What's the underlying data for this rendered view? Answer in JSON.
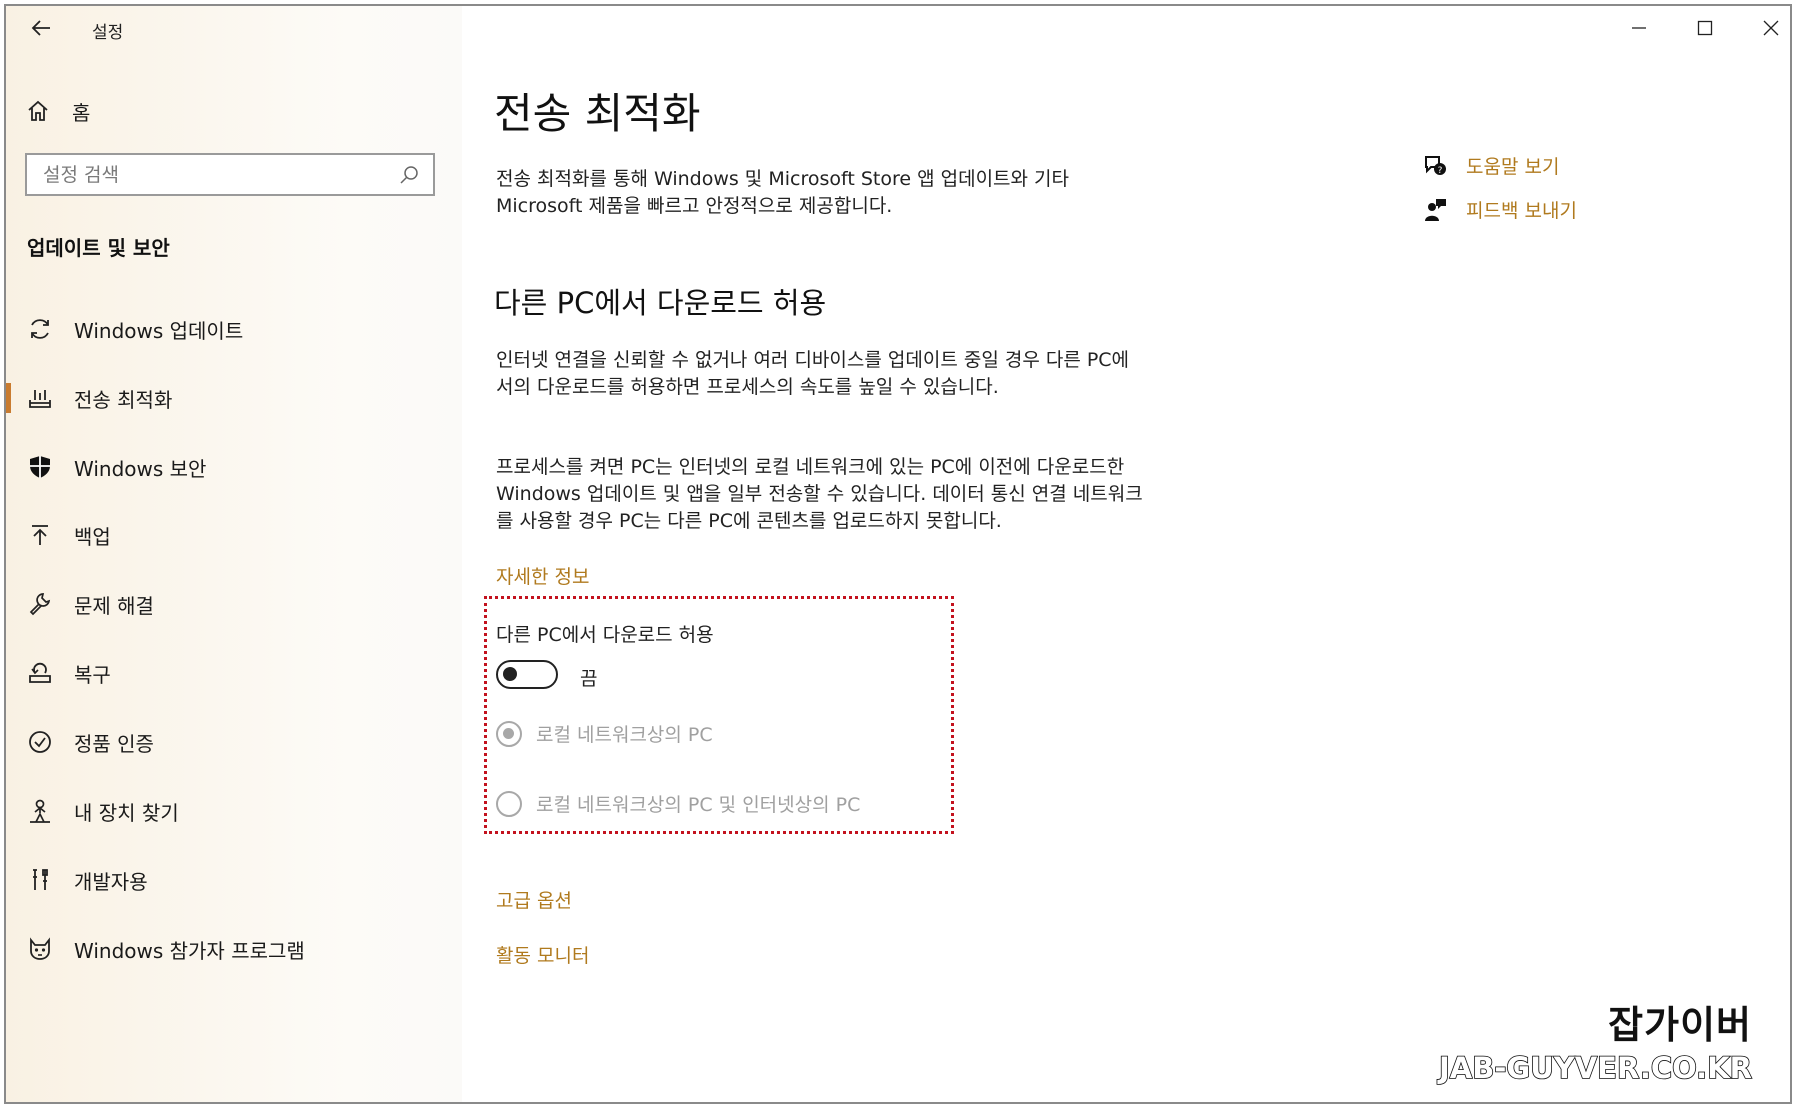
{
  "window": {
    "title": "설정"
  },
  "sidebar": {
    "home_label": "홈",
    "search_placeholder": "설정 검색",
    "section_heading": "업데이트 및 보안",
    "items": [
      {
        "label": "Windows 업데이트",
        "icon": "sync-icon"
      },
      {
        "label": "전송 최적화",
        "icon": "delivery-optimization-icon",
        "selected": true
      },
      {
        "label": "Windows 보안",
        "icon": "shield-icon"
      },
      {
        "label": "백업",
        "icon": "backup-arrow-icon"
      },
      {
        "label": "문제 해결",
        "icon": "wrench-icon"
      },
      {
        "label": "복구",
        "icon": "recovery-icon"
      },
      {
        "label": "정품 인증",
        "icon": "check-circle-icon"
      },
      {
        "label": "내 장치 찾기",
        "icon": "person-locate-icon"
      },
      {
        "label": "개발자용",
        "icon": "developer-tools-icon"
      },
      {
        "label": "Windows 참가자 프로그램",
        "icon": "insider-cat-icon"
      }
    ]
  },
  "main": {
    "title": "전송 최적화",
    "description": "전송 최적화를 통해 Windows 및 Microsoft Store 앱 업데이트와 기타 Microsoft 제품을 빠르고 안정적으로 제공합니다.",
    "section_title": "다른 PC에서 다운로드 허용",
    "para1": "인터넷 연결을 신뢰할 수 없거나 여러 디바이스를 업데이트 중일 경우 다른 PC에서의 다운로드를 허용하면 프로세스의 속도를 높일 수 있습니다.",
    "para2": "프로세스를 켜면 PC는 인터넷의 로컬 네트워크에 있는 PC에 이전에 다운로드한 Windows 업데이트 및 앱을 일부 전송할 수 있습니다. 데이터 통신 연결 네트워크를 사용할 경우 PC는 다른 PC에 콘텐츠를 업로드하지 못합니다.",
    "more_info_link": "자세한 정보",
    "toggle": {
      "label": "다른 PC에서 다운로드 허용",
      "state_text": "끔",
      "on": false
    },
    "radios": [
      {
        "label": "로컬 네트워크상의 PC",
        "checked": true,
        "disabled": true
      },
      {
        "label": "로컬 네트워크상의 PC 및 인터넷상의 PC",
        "checked": false,
        "disabled": true
      }
    ],
    "advanced_link": "고급 옵션",
    "activity_link": "활동 모니터"
  },
  "aside": {
    "help_link": "도움말 보기",
    "feedback_link": "피드백 보내기"
  },
  "watermark": {
    "line1": "잡가이버",
    "line2": "JAB-GUYVER.CO.KR"
  },
  "colors": {
    "accent": "#b07a1e",
    "selection_bar": "#c97b2f",
    "highlight_box": "#c3121e"
  }
}
